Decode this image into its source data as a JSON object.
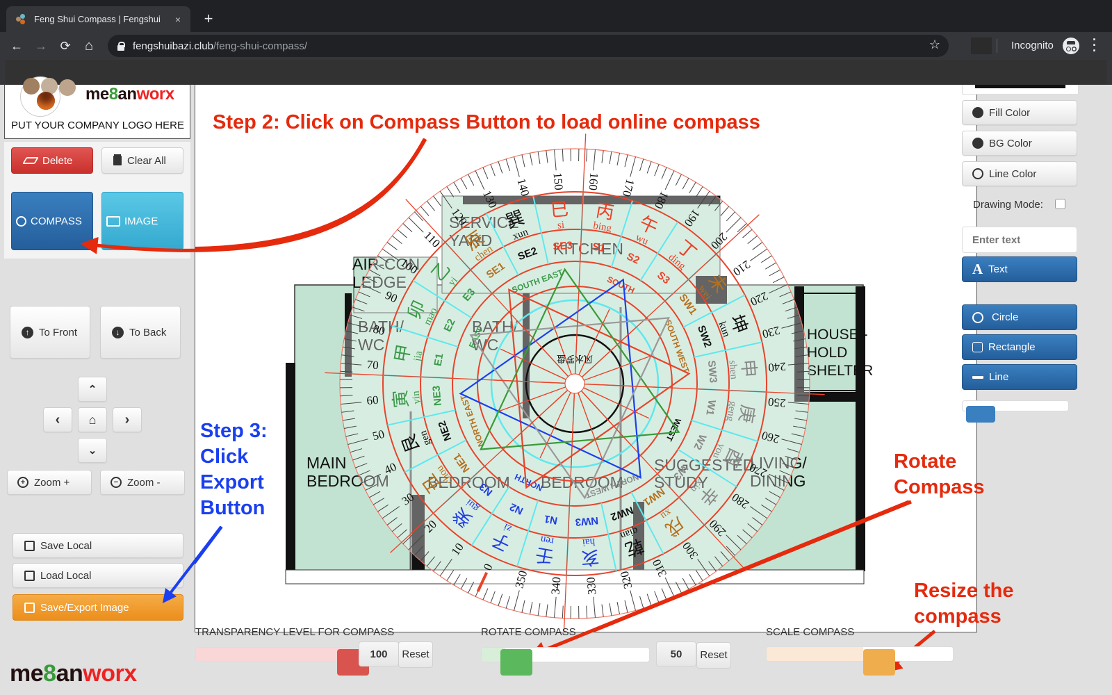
{
  "browser": {
    "tab_title": "Feng Shui Compass | Fengshui",
    "tab_close": "×",
    "new_tab": "+",
    "url_host": "fengshuibazi.club",
    "url_path": "/feng-shui-compass/",
    "incognito_label": "Incognito",
    "nav": {
      "back": "←",
      "forward": "→",
      "reload": "⟳",
      "home": "⌂",
      "star": "☆",
      "menu": "⋮"
    }
  },
  "left_panel": {
    "logo": {
      "brand_prefix": "me",
      "brand_eight": "8",
      "brand_mid": "an",
      "brand_suffix": "worx",
      "caption": "PUT YOUR COMPANY LOGO HERE"
    },
    "delete_label": "Delete",
    "clear_all_label": "Clear All",
    "compass_label": "COMPASS",
    "image_label": "IMAGE",
    "to_front_label": "To Front",
    "to_back_label": "To Back",
    "pad": {
      "up": "⌃",
      "left": "‹",
      "home": "⌂",
      "right": "›",
      "down": "⌄"
    },
    "zoom_in_label": "Zoom +",
    "zoom_out_label": "Zoom -",
    "save_local_label": "Save Local",
    "load_local_label": "Load Local",
    "save_export_label": "Save/Export Image",
    "footer_brand": {
      "prefix": "me",
      "eight": "8",
      "mid": "an",
      "suffix": "worx"
    }
  },
  "right_panel": {
    "fill_color_label": "Fill Color",
    "bg_color_label": "BG Color",
    "line_color_label": "Line Color",
    "drawing_mode_label": "Drawing Mode:",
    "drawing_mode_checked": false,
    "text_input_placeholder": "Enter text",
    "text_button_label": "Text",
    "text_button_glyph": "A",
    "circle_label": "Circle",
    "rectangle_label": "Rectangle",
    "line_label": "Line",
    "stroke_slider_fraction": 0.05
  },
  "canvas": {
    "annotations": {
      "step2": "Step 2: Click on Compass Button to load online compass",
      "step3_lines": [
        "Step 3:",
        "Click",
        "Export",
        "Button"
      ],
      "rotate_lines": [
        "Rotate",
        "Compass"
      ],
      "resize_lines": [
        "Resize the",
        "compass"
      ]
    },
    "rooms": {
      "service_yard": [
        "SERVICE",
        "YARD"
      ],
      "aircon": [
        "AIR-CON",
        "LEDGE"
      ],
      "kitchen": "KITCHEN",
      "bath1": [
        "BATH/",
        "WC"
      ],
      "bath2": [
        "BATH/",
        "WC"
      ],
      "household": [
        "HOUSE -",
        "HOLD",
        "SHELTER"
      ],
      "main_bedroom": [
        "MAIN",
        "BEDROOM"
      ],
      "bedroom2": "BEDROOM",
      "bedroom3": "BEDROOM",
      "study": [
        "SUGGESTED",
        "STUDY"
      ],
      "living": [
        "LIVING/",
        "DINING"
      ]
    },
    "compass": {
      "degree_labels": [
        "0",
        "10",
        "20",
        "30",
        "40",
        "50",
        "60",
        "70",
        "80",
        "90",
        "100",
        "110",
        "120",
        "130",
        "140",
        "150",
        "160",
        "170",
        "180",
        "190",
        "200",
        "210",
        "220",
        "230",
        "240",
        "250",
        "260",
        "270",
        "280",
        "290",
        "300",
        "310",
        "320",
        "330",
        "340",
        "350"
      ],
      "mountains": [
        {
          "code": "N2",
          "hanzi": "子",
          "pinyin": "zi",
          "color": "#1f3de0"
        },
        {
          "code": "N3",
          "hanzi": "癸",
          "pinyin": "gui",
          "color": "#1f3de0"
        },
        {
          "code": "NE1",
          "hanzi": "丑",
          "pinyin": "chou",
          "color": "#b5701f"
        },
        {
          "code": "NE2",
          "hanzi": "艮",
          "pinyin": "gen",
          "color": "#111111"
        },
        {
          "code": "NE3",
          "hanzi": "寅",
          "pinyin": "yin",
          "color": "#3a9a4a"
        },
        {
          "code": "E1",
          "hanzi": "甲",
          "pinyin": "jia",
          "color": "#3a9a4a"
        },
        {
          "code": "E2",
          "hanzi": "卯",
          "pinyin": "mao",
          "color": "#3a9a4a"
        },
        {
          "code": "E3",
          "hanzi": "乙",
          "pinyin": "yi",
          "color": "#3a9a4a"
        },
        {
          "code": "SE1",
          "hanzi": "辰",
          "pinyin": "chen",
          "color": "#b5701f"
        },
        {
          "code": "SE2",
          "hanzi": "巽",
          "pinyin": "xun",
          "color": "#111111"
        },
        {
          "code": "SE3",
          "hanzi": "巳",
          "pinyin": "si",
          "color": "#e8432a"
        },
        {
          "code": "S1",
          "hanzi": "丙",
          "pinyin": "bing",
          "color": "#e8432a"
        },
        {
          "code": "S2",
          "hanzi": "午",
          "pinyin": "wu",
          "color": "#e8432a"
        },
        {
          "code": "S3",
          "hanzi": "丁",
          "pinyin": "ding",
          "color": "#e8432a"
        },
        {
          "code": "SW1",
          "hanzi": "未",
          "pinyin": "wei",
          "color": "#b5701f"
        },
        {
          "code": "SW2",
          "hanzi": "坤",
          "pinyin": "kun",
          "color": "#111111"
        },
        {
          "code": "SW3",
          "hanzi": "申",
          "pinyin": "shen",
          "color": "#888888"
        },
        {
          "code": "W1",
          "hanzi": "庚",
          "pinyin": "geng",
          "color": "#888888"
        },
        {
          "code": "W2",
          "hanzi": "酉",
          "pinyin": "you",
          "color": "#888888"
        },
        {
          "code": "W3",
          "hanzi": "辛",
          "pinyin": "xin",
          "color": "#888888"
        },
        {
          "code": "NW1",
          "hanzi": "戌",
          "pinyin": "xu",
          "color": "#b5701f"
        },
        {
          "code": "NW2",
          "hanzi": "乾",
          "pinyin": "qian",
          "color": "#111111"
        },
        {
          "code": "NW3",
          "hanzi": "亥",
          "pinyin": "hai",
          "color": "#1f3de0"
        },
        {
          "code": "N1",
          "hanzi": "壬",
          "pinyin": "ren",
          "color": "#1f3de0"
        }
      ],
      "directions": [
        {
          "label": "NORTH",
          "color": "#1f3de0"
        },
        {
          "label": "NORTH EAST",
          "color": "#b5701f"
        },
        {
          "label": "EAST",
          "color": "#3a9a4a"
        },
        {
          "label": "SOUTH EAST",
          "color": "#3a9a4a"
        },
        {
          "label": "SOUTH",
          "color": "#e8432a"
        },
        {
          "label": "SOUTH WEST",
          "color": "#b5701f"
        },
        {
          "label": "WEST",
          "color": "#111111"
        },
        {
          "label": "NORTH WEST",
          "color": "#888888"
        }
      ],
      "center_text": "风水罗盘"
    }
  },
  "bottom_controls": {
    "transparency": {
      "label": "TRANSPARENCY LEVEL FOR COMPASS",
      "value": "100",
      "fraction": 1.0,
      "reset": "Reset",
      "color": "#d9534f",
      "fill_color": "#f8d7d6"
    },
    "rotate": {
      "label": "ROTATE COMPASS",
      "value": "50",
      "fraction": 0.14,
      "reset": "Reset",
      "color": "#5cb85c",
      "fill_color": "#d8eed8"
    },
    "scale": {
      "label": "SCALE COMPASS",
      "fraction": 0.52,
      "color": "#f0ad4e",
      "fill_color": "#fce8d6"
    }
  }
}
